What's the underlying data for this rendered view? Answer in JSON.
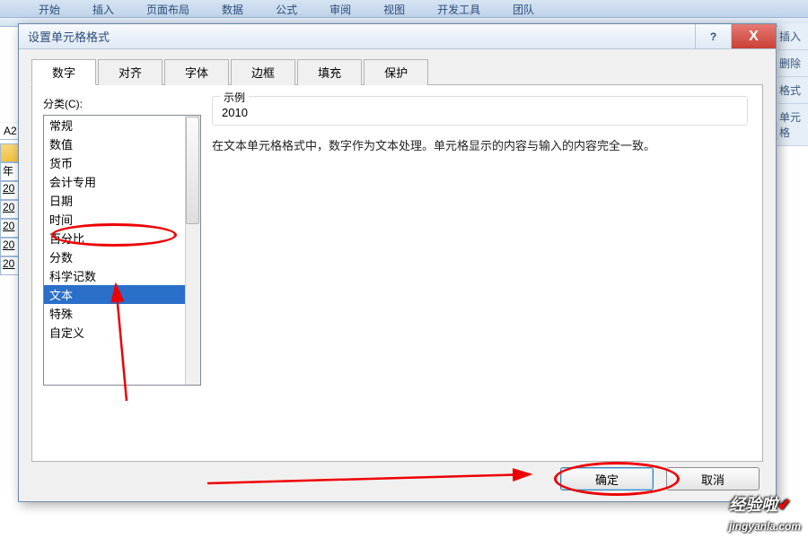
{
  "ribbon": {
    "tabs": [
      "开始",
      "插入",
      "页面布局",
      "数据",
      "公式",
      "审阅",
      "视图",
      "开发工具",
      "团队"
    ]
  },
  "right_strip": [
    "插入",
    "删除",
    "格式",
    "单元格"
  ],
  "formula": {
    "name_box": "A2"
  },
  "sheet": {
    "year_label": "年",
    "rows": [
      "20",
      "20",
      "20",
      "20",
      "20"
    ]
  },
  "dialog": {
    "title": "设置单元格格式",
    "help": "?",
    "close": "X",
    "tabs": [
      "数字",
      "对齐",
      "字体",
      "边框",
      "填充",
      "保护"
    ],
    "category_label": "分类(C):",
    "categories": [
      "常规",
      "数值",
      "货币",
      "会计专用",
      "日期",
      "时间",
      "百分比",
      "分数",
      "科学记数",
      "文本",
      "特殊",
      "自定义"
    ],
    "selected_category_index": 9,
    "example_label": "示例",
    "example_value": "2010",
    "description": "在文本单元格格式中，数字作为文本处理。单元格显示的内容与输入的内容完全一致。",
    "ok": "确定",
    "cancel": "取消"
  },
  "watermark": {
    "text": "经验啦",
    "url": "jingyanla.com",
    "check": "✔"
  }
}
